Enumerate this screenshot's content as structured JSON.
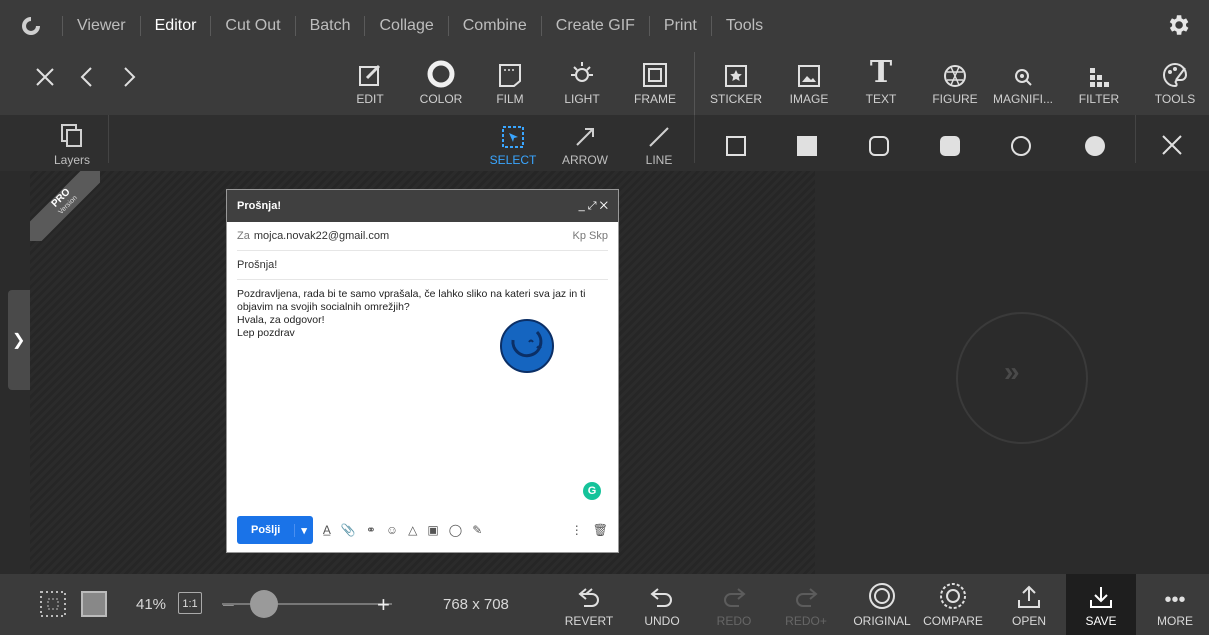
{
  "nav": {
    "items": [
      "Viewer",
      "Editor",
      "Cut Out",
      "Batch",
      "Collage",
      "Combine",
      "Create GIF",
      "Print",
      "Tools"
    ],
    "active": "Editor"
  },
  "toolbar": {
    "tools": [
      "EDIT",
      "COLOR",
      "FILM",
      "LIGHT",
      "FRAME",
      "STICKER",
      "IMAGE",
      "TEXT",
      "FIGURE",
      "MAGNIFI...",
      "FILTER",
      "TOOLS"
    ]
  },
  "subbar": {
    "layers": "Layers",
    "select": "SELECT",
    "arrow": "ARROW",
    "line": "LINE"
  },
  "pro_badge": {
    "title": "PRO",
    "sub": "Version"
  },
  "email": {
    "window_title": "Prošnja!",
    "to_label": "Za",
    "to_value": "mojca.novak22@gmail.com",
    "cc_bcc": "Kp Skp",
    "subject": "Prošnja!",
    "body_lines": [
      "Pozdravljena, rada bi te samo vprašala, če lahko sliko na kateri sva jaz in ti",
      "objavim na svojih socialnih omrežjih?",
      "Hvala, za odgovor!",
      "Lep pozdrav"
    ],
    "send_label": "Pošlji",
    "grammarly": "G"
  },
  "bottom": {
    "zoom": "41%",
    "one_to_one": "1:1",
    "minus": "−",
    "plus": "+",
    "dimensions": "768 x 708",
    "buttons": [
      "REVERT",
      "UNDO",
      "REDO",
      "REDO+",
      "ORIGINAL",
      "COMPARE",
      "OPEN",
      "SAVE",
      "MORE"
    ]
  },
  "colors": {
    "accent": "#3aa6ff",
    "send_button": "#1a73e8",
    "smiley": "#1565c0"
  }
}
